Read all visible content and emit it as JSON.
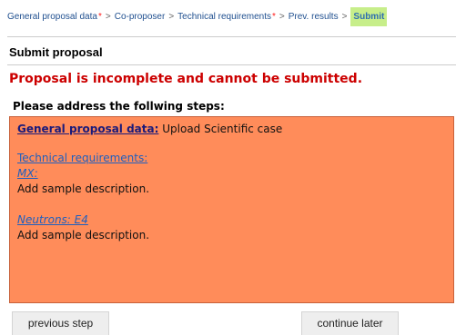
{
  "breadcrumb": {
    "items": [
      {
        "label": "General proposal data",
        "required": "*"
      },
      {
        "label": "Co-proposer",
        "required": ""
      },
      {
        "label": "Technical requirements",
        "required": "*"
      },
      {
        "label": "Prev. results",
        "required": ""
      }
    ],
    "separator": ">",
    "current": "Submit"
  },
  "page": {
    "title": "Submit proposal",
    "error": "Proposal is incomplete and cannot be submitted.",
    "steps_heading": "Please address the follwing steps:"
  },
  "steps": {
    "general": {
      "link": "General proposal data:",
      "text": "Upload Scientific case"
    },
    "technical": {
      "link": "Technical requirements:",
      "items": [
        {
          "link": "MX:",
          "text": "Add sample description."
        },
        {
          "link": "Neutrons: E4",
          "text": "Add sample description."
        }
      ]
    }
  },
  "buttons": {
    "previous": "previous step",
    "continue_later": "continue later"
  },
  "colors": {
    "steps_box": "#ff8c5a",
    "error": "#cc0000",
    "current_crumb_bg": "#c7ee8a",
    "required_marker": "#ff1a1a"
  }
}
